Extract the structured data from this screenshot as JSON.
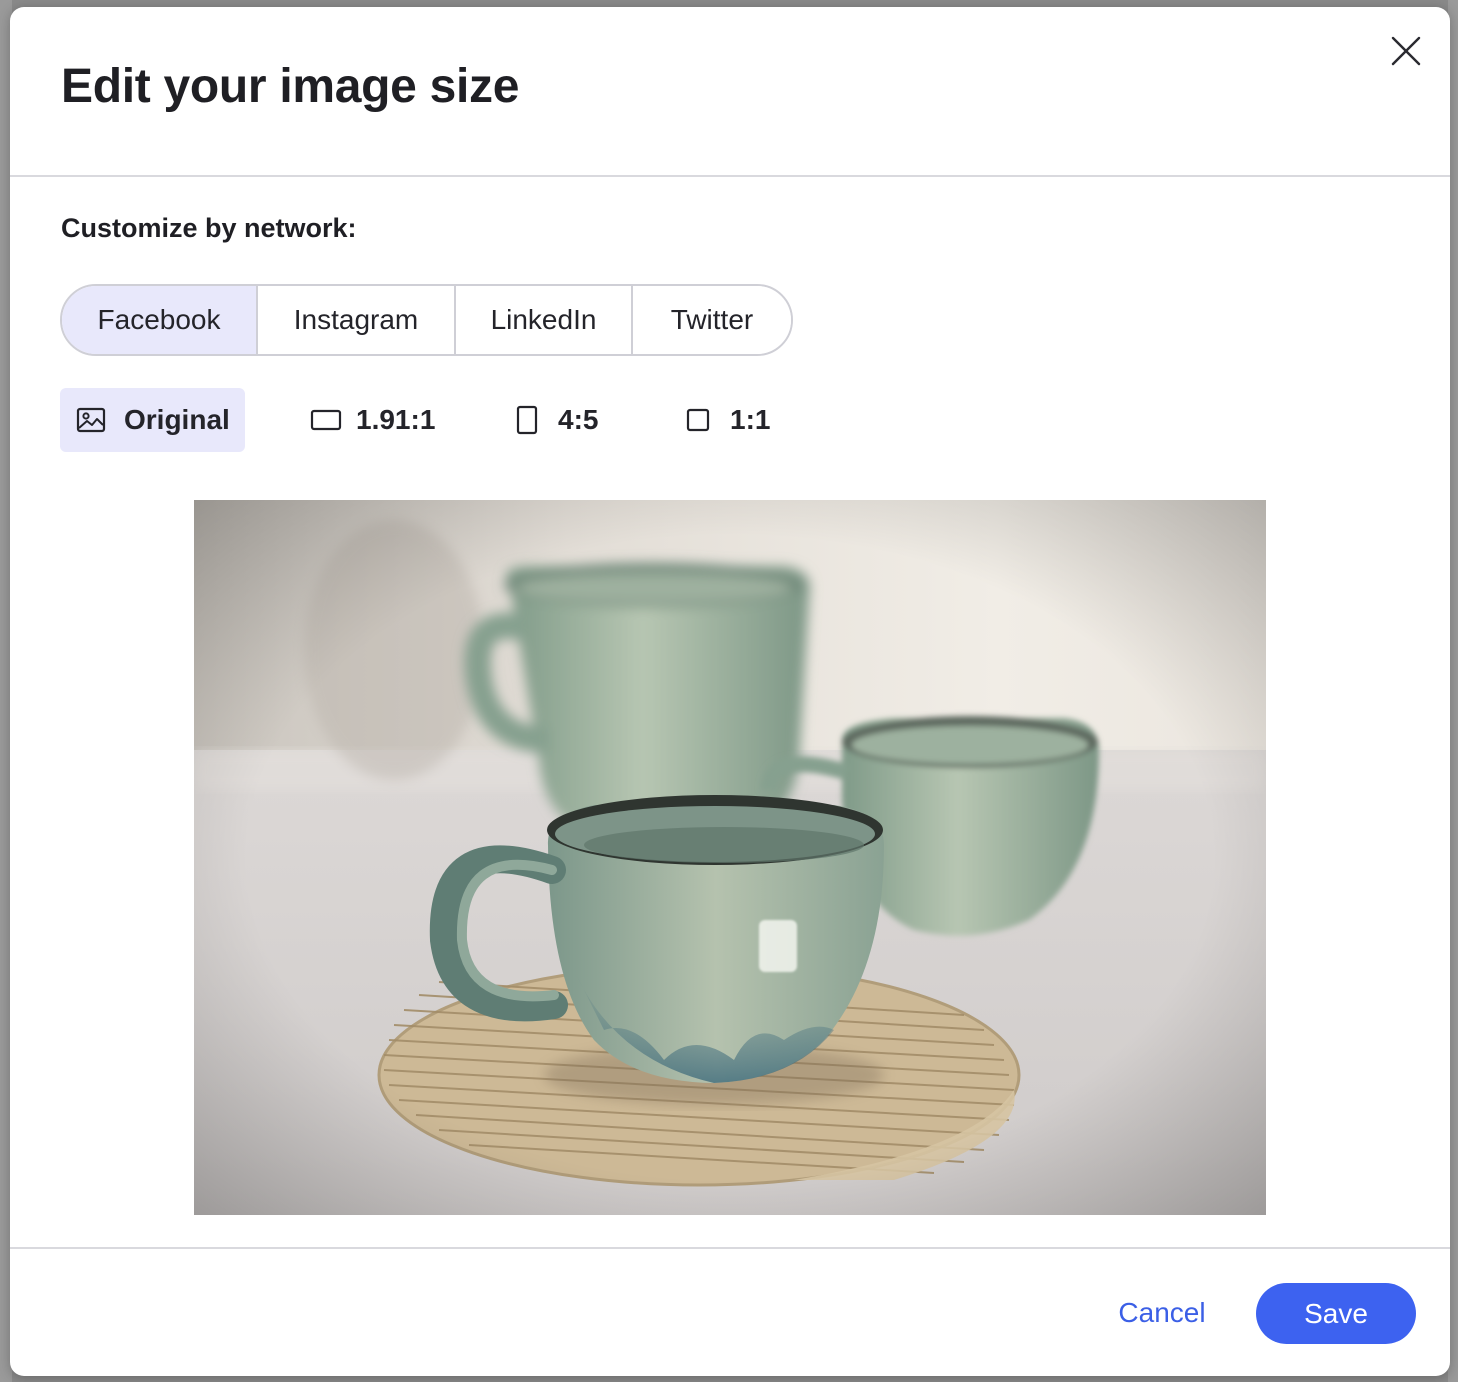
{
  "modal": {
    "title": "Edit your image size",
    "section_label": "Customize by network:"
  },
  "network_tabs": [
    {
      "label": "Facebook",
      "active": true
    },
    {
      "label": "Instagram",
      "active": false
    },
    {
      "label": "LinkedIn",
      "active": false
    },
    {
      "label": "Twitter",
      "active": false
    }
  ],
  "aspect_ratios": [
    {
      "label": "Original",
      "icon": "image-icon",
      "active": true
    },
    {
      "label": "1.91:1",
      "icon": "landscape-rectangle-icon",
      "active": false
    },
    {
      "label": "4:5",
      "icon": "portrait-rectangle-icon",
      "active": false
    },
    {
      "label": "1:1",
      "icon": "square-icon",
      "active": false
    }
  ],
  "preview": {
    "icon": "photo-of-ceramic-cups"
  },
  "footer": {
    "cancel_label": "Cancel",
    "save_label": "Save"
  },
  "colors": {
    "accent": "#3d62f0",
    "link": "#3b5fe6",
    "active_bg": "#e8e8fb",
    "text": "#1f1f24"
  }
}
